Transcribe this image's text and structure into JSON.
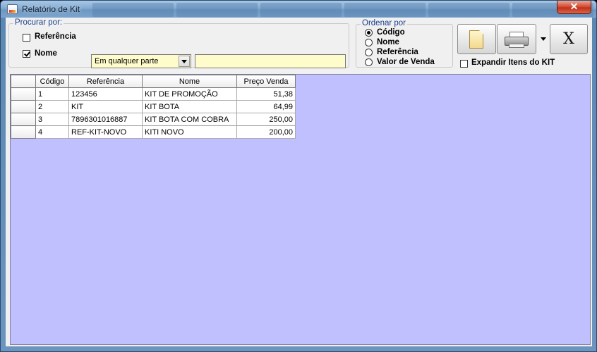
{
  "window": {
    "title": "Relatório de Kit",
    "close_glyph": "✕",
    "accent": "#c0c0ff",
    "input_bg": "#fffccc"
  },
  "procurar": {
    "legend": "Procurar por:",
    "referencia": {
      "label": "Referência",
      "checked": false
    },
    "nome": {
      "label": "Nome",
      "checked": true
    },
    "mode_selected": "Em qualquer parte",
    "search_value": ""
  },
  "ordenar": {
    "legend": "Ordenar por",
    "options": [
      {
        "label": "Código",
        "checked": true
      },
      {
        "label": "Nome",
        "checked": false
      },
      {
        "label": "Referência",
        "checked": false
      },
      {
        "label": "Valor de Venda",
        "checked": false
      }
    ]
  },
  "toolbar": {
    "new_icon": "document-icon",
    "print_icon": "printer-icon",
    "close_label": "X"
  },
  "expandir": {
    "label": "Expandir Itens do KIT",
    "checked": false
  },
  "grid": {
    "columns": [
      "Código",
      "Referência",
      "Nome",
      "Preço Venda"
    ],
    "rows": [
      [
        "1",
        "123456",
        "KIT DE PROMOÇÃO",
        "51,38"
      ],
      [
        "2",
        "KIT",
        "KIT BOTA",
        "64,99"
      ],
      [
        "3",
        "7896301016887",
        "KIT BOTA COM COBRA",
        "250,00"
      ],
      [
        "4",
        "REF-KIT-NOVO",
        "KITI NOVO",
        "200,00"
      ]
    ]
  }
}
